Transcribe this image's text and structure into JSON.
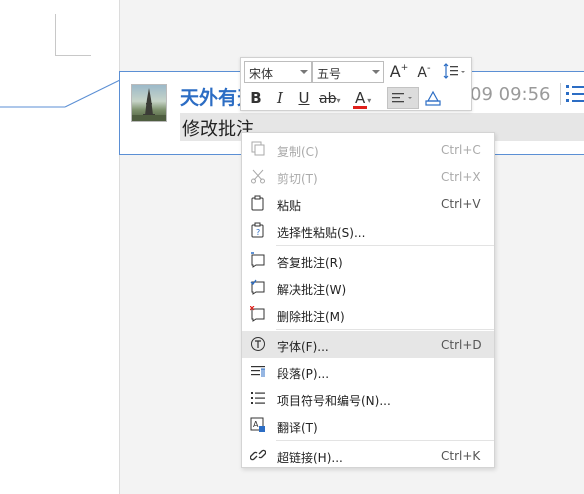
{
  "comment": {
    "author": "天外有天",
    "time": "09 09:56",
    "text": "修改批注"
  },
  "toolbar": {
    "font_name": "宋体",
    "font_size": "五号",
    "grow_font": "A",
    "shrink_font": "A",
    "bold": "B",
    "italic": "I",
    "underline": "U",
    "strikethrough": "ab",
    "font_color": "A"
  },
  "menu": {
    "items": [
      {
        "label": "复制(C)",
        "shortcut": "Ctrl+C",
        "icon": "copy-icon"
      },
      {
        "label": "剪切(T)",
        "shortcut": "Ctrl+X",
        "icon": "scissors-icon"
      },
      {
        "label": "粘贴",
        "shortcut": "Ctrl+V",
        "icon": "paste-icon"
      },
      {
        "label": "选择性粘贴(S)...",
        "shortcut": "",
        "icon": "paste-special-icon"
      },
      {
        "label": "答复批注(R)",
        "shortcut": "",
        "icon": "reply-comment-icon"
      },
      {
        "label": "解决批注(W)",
        "shortcut": "",
        "icon": "resolve-comment-icon"
      },
      {
        "label": "删除批注(M)",
        "shortcut": "",
        "icon": "delete-comment-icon"
      },
      {
        "label": "字体(F)...",
        "shortcut": "Ctrl+D",
        "icon": "font-icon"
      },
      {
        "label": "段落(P)...",
        "shortcut": "",
        "icon": "paragraph-icon"
      },
      {
        "label": "项目符号和编号(N)...",
        "shortcut": "",
        "icon": "bullets-icon"
      },
      {
        "label": "翻译(T)",
        "shortcut": "",
        "icon": "translate-icon"
      },
      {
        "label": "超链接(H)...",
        "shortcut": "Ctrl+K",
        "icon": "hyperlink-icon"
      }
    ]
  },
  "colors": {
    "accent": "#2c6dc4",
    "card_border": "#5b8fd4",
    "font_color_bar": "#e0201b",
    "highlight": "#e6e6e6"
  }
}
